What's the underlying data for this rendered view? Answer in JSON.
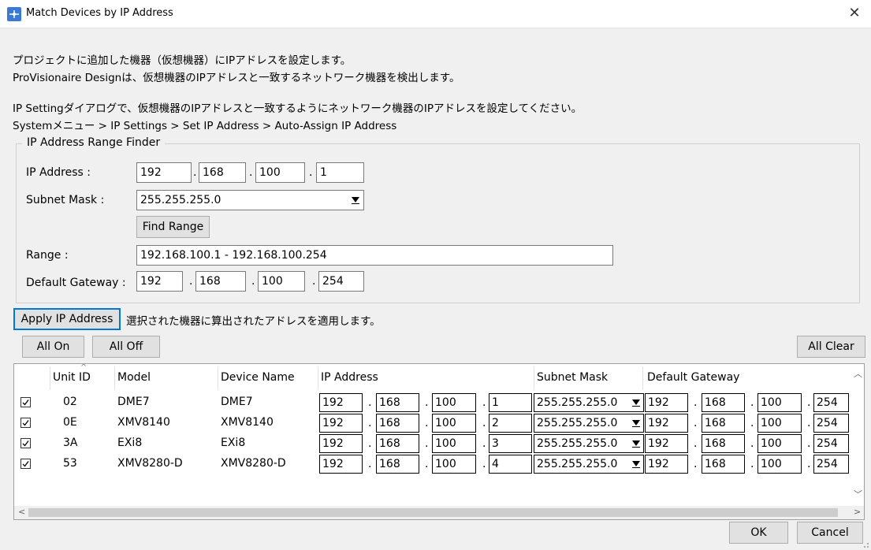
{
  "window": {
    "title": "Match Devices by IP Address",
    "icon": "app-network-icon",
    "close_label": "✕"
  },
  "intro": {
    "line1": "プロジェクトに追加した機器（仮想機器）にIPアドレスを設定します。",
    "line2": "ProVisionaire Designは、仮想機器のIPアドレスと一致するネットワーク機器を検出します。",
    "line3": "IP Settingダイアログで、仮想機器のIPアドレスと一致するようにネットワーク機器のIPアドレスを設定してください。",
    "line4": "Systemメニュー > IP Settings > Set IP Address > Auto-Assign IP Address"
  },
  "finder": {
    "legend": "IP Address Range Finder",
    "ip_label": "IP Address :",
    "ip": [
      "192",
      "168",
      "100",
      "1"
    ],
    "subnet_label": "Subnet Mask :",
    "subnet_value": "255.255.255.0",
    "find_range_label": "Find Range",
    "range_label": "Range :",
    "range_value": "192.168.100.1 - 192.168.100.254",
    "gateway_label": "Default Gateway :",
    "gateway": [
      "192",
      "168",
      "100",
      "254"
    ],
    "dot": "."
  },
  "apply": {
    "button_label": "Apply IP Address",
    "description": "選択された機器に算出されたアドレスを適用します。"
  },
  "toolbar": {
    "all_on": "All On",
    "all_off": "All Off",
    "all_clear": "All Clear"
  },
  "table": {
    "headers": {
      "unit_id": "Unit ID",
      "model": "Model",
      "device_name": "Device Name",
      "ip_address": "IP Address",
      "subnet_mask": "Subnet Mask",
      "default_gateway": "Default Gateway"
    },
    "rows": [
      {
        "checked": true,
        "unit_id": "02",
        "model": "DME7",
        "device_name": "DME7",
        "ip": [
          "192",
          "168",
          "100",
          "1"
        ],
        "subnet": "255.255.255.0",
        "gateway": [
          "192",
          "168",
          "100",
          "254"
        ]
      },
      {
        "checked": true,
        "unit_id": "0E",
        "model": "XMV8140",
        "device_name": "XMV8140",
        "ip": [
          "192",
          "168",
          "100",
          "2"
        ],
        "subnet": "255.255.255.0",
        "gateway": [
          "192",
          "168",
          "100",
          "254"
        ]
      },
      {
        "checked": true,
        "unit_id": "3A",
        "model": "EXi8",
        "device_name": "EXi8",
        "ip": [
          "192",
          "168",
          "100",
          "3"
        ],
        "subnet": "255.255.255.0",
        "gateway": [
          "192",
          "168",
          "100",
          "254"
        ]
      },
      {
        "checked": true,
        "unit_id": "53",
        "model": "XMV8280-D",
        "device_name": "XMV8280-D",
        "ip": [
          "192",
          "168",
          "100",
          "4"
        ],
        "subnet": "255.255.255.0",
        "gateway": [
          "192",
          "168",
          "100",
          "254"
        ]
      }
    ]
  },
  "footer": {
    "ok": "OK",
    "cancel": "Cancel"
  }
}
